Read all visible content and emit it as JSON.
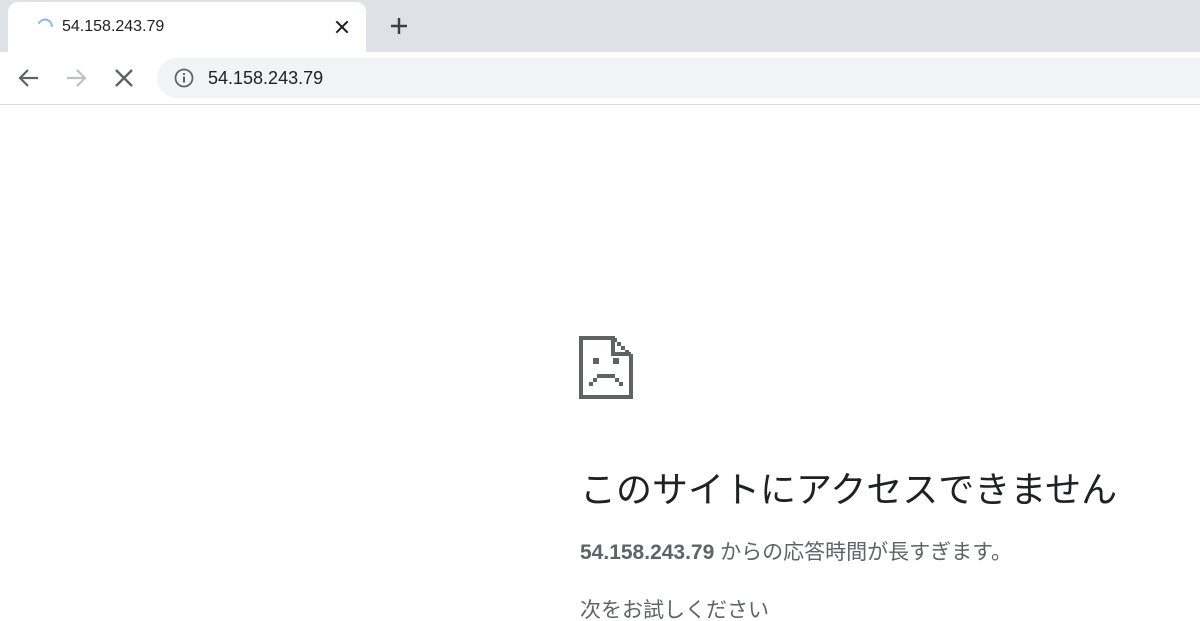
{
  "tab": {
    "title": "54.158.243.79",
    "loading_icon": "spinner-icon",
    "close_icon": "close-icon"
  },
  "new_tab_icon": "plus-icon",
  "toolbar": {
    "back_icon": "arrow-left-icon",
    "forward_icon": "arrow-right-icon",
    "stop_icon": "stop-icon",
    "site_info_icon": "info-icon",
    "url": "54.158.243.79"
  },
  "error_page": {
    "icon": "sad-page-icon",
    "heading": "このサイトにアクセスできません",
    "host": "54.158.243.79",
    "message": " からの応答時間が長すぎます。",
    "try_heading": "次をお試しください"
  },
  "colors": {
    "tabstrip_bg": "#dee1e6",
    "omnibox_bg": "#f1f3f4",
    "spinner": "#8ab4f8",
    "heading_text": "#202124",
    "body_text": "#5f6368"
  }
}
